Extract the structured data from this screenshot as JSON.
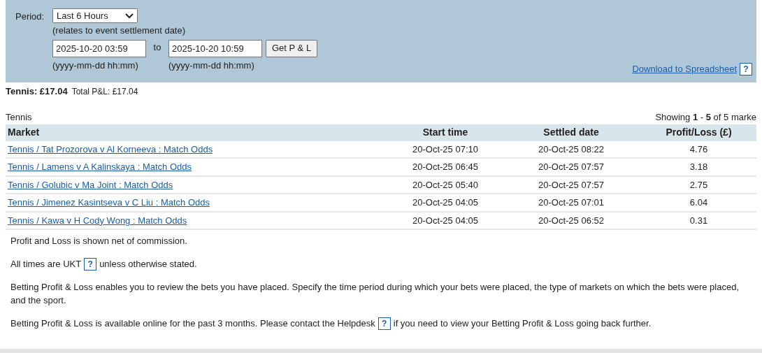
{
  "filter": {
    "period_label": "Period:",
    "period_select": "Last 6 Hours",
    "period_note": "(relates to event settlement date)",
    "from": {
      "value": "2025-10-20 03:59",
      "hint": "(yyyy-mm-dd hh:mm)"
    },
    "to_label": "to",
    "to": {
      "value": "2025-10-20 10:59",
      "hint": "(yyyy-mm-dd hh:mm)"
    },
    "button": "Get P & L",
    "download_link": "Download to Spreadsheet",
    "download_help": "?"
  },
  "summary": {
    "sport_total": "Tennis: £17.04",
    "total": "Total P&L: £17.04"
  },
  "table": {
    "caption": "Tennis",
    "showing": "Showing **1** - **5** of 5 marke",
    "columns": [
      "Market",
      "Start time",
      "Settled date",
      "Profit/Loss (£)"
    ],
    "rows": [
      {
        "market": "Tennis / Tat Prozorova v Al Korneeva : Match Odds",
        "start": "20-Oct-25 07:10",
        "settled": "20-Oct-25 08:22",
        "pl": "4.76"
      },
      {
        "market": "Tennis / Lamens v A Kalinskaya : Match Odds",
        "start": "20-Oct-25 06:45",
        "settled": "20-Oct-25 07:57",
        "pl": "3.18"
      },
      {
        "market": "Tennis / Golubic v Ma Joint : Match Odds",
        "start": "20-Oct-25 05:40",
        "settled": "20-Oct-25 07:57",
        "pl": "2.75"
      },
      {
        "market": "Tennis / Jimenez Kasintseva v C Liu : Match Odds",
        "start": "20-Oct-25 04:05",
        "settled": "20-Oct-25 07:01",
        "pl": "6.04"
      },
      {
        "market": "Tennis / Kawa v H Cody Wong : Match Odds",
        "start": "20-Oct-25 04:05",
        "settled": "20-Oct-25 06:52",
        "pl": "0.31"
      }
    ]
  },
  "notes": [
    {
      "kind": "plain",
      "text": "Profit and Loss is shown net of commission."
    },
    {
      "kind": "help",
      "before": "All times are UKT",
      "help": "?",
      "after": "unless otherwise stated."
    },
    {
      "kind": "plain",
      "text": "Betting Profit & Loss enables you to review the bets you have placed. Specify the time period during which your bets were placed, the type of markets on which the bets were placed, and the sport."
    },
    {
      "kind": "help",
      "before": "Betting Profit & Loss is available online for the past 3 months. Please contact the Helpdesk",
      "help": "?",
      "after": "if you need to view your Betting Profit & Loss going back further."
    }
  ]
}
